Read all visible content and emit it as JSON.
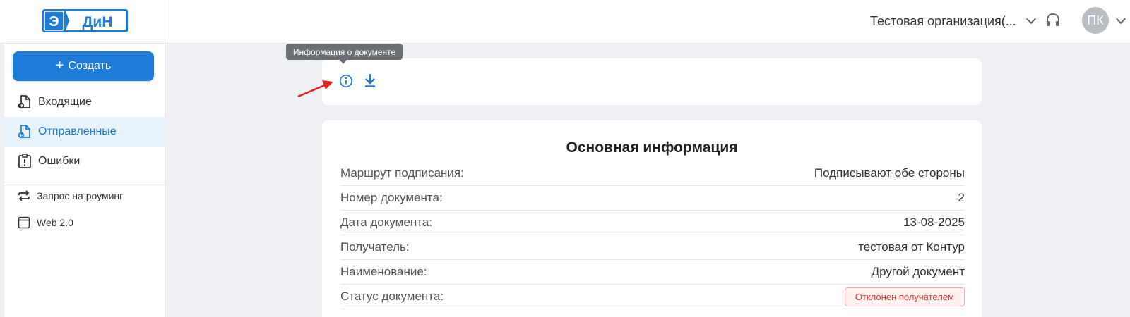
{
  "header": {
    "logo_text": "ЭДиН",
    "organization": "Тестовая организация(...",
    "avatar_initials": "ПК"
  },
  "sidebar": {
    "create_label": "Создать",
    "items": [
      {
        "label": "Входящие",
        "icon": "incoming-doc-icon",
        "active": false
      },
      {
        "label": "Отправленные",
        "icon": "outgoing-doc-icon",
        "active": true
      },
      {
        "label": "Ошибки",
        "icon": "error-doc-icon",
        "active": false
      },
      {
        "label": "Запрос на роуминг",
        "icon": "roaming-icon",
        "active": false
      },
      {
        "label": "Web 2.0",
        "icon": "web-icon",
        "active": false
      }
    ]
  },
  "toolbar": {
    "tooltip": "Информация о документе",
    "icons": [
      "info-icon",
      "download-icon"
    ]
  },
  "info": {
    "title": "Основная информация",
    "rows": [
      {
        "label": "Маршрут подписания:",
        "value": "Подписывают обе стороны"
      },
      {
        "label": "Номер документа:",
        "value": "2"
      },
      {
        "label": "Дата документа:",
        "value": "13-08-2025"
      },
      {
        "label": "Получатель:",
        "value": "тестовая от Контур"
      },
      {
        "label": "Наименование:",
        "value": "Другой документ"
      },
      {
        "label": "Статус документа:",
        "value": "Отклонен получателем"
      }
    ]
  },
  "colors": {
    "accent": "#1f7bd8",
    "status_rejected": "#e03b3b",
    "annotation_arrow": "#e3201b"
  }
}
